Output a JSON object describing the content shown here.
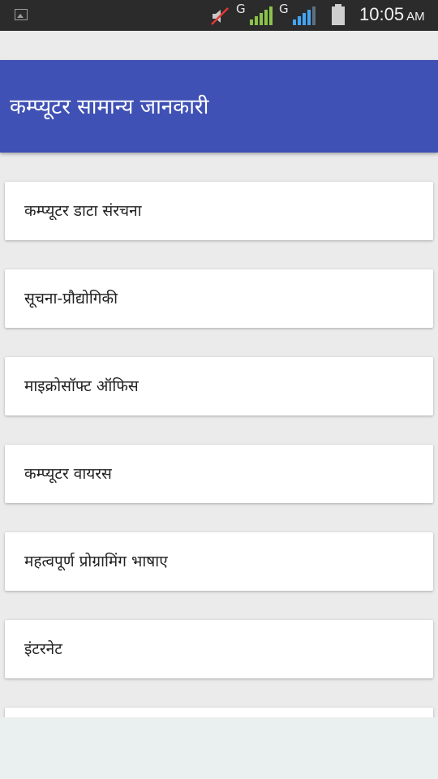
{
  "status_bar": {
    "time": "10:05",
    "ampm": "AM",
    "network_1": "G",
    "network_2": "G",
    "icons": [
      "image-notification-icon",
      "mute-icon",
      "signal-icon",
      "battery-icon"
    ]
  },
  "app_bar": {
    "title": "कम्प्यूटर सामान्य जानकारी",
    "color": "#3f51b5"
  },
  "list": {
    "items": [
      {
        "label": "कम्प्यूटर डाटा संरचना"
      },
      {
        "label": "सूचना-प्रौद्योगिकी"
      },
      {
        "label": "माइक्रोसॉफ्ट ऑफिस"
      },
      {
        "label": "कम्प्यूटर वायरस"
      },
      {
        "label": "महत्वपूर्ण प्रोग्रामिंग भाषाए"
      },
      {
        "label": "इंटरनेट"
      }
    ]
  }
}
